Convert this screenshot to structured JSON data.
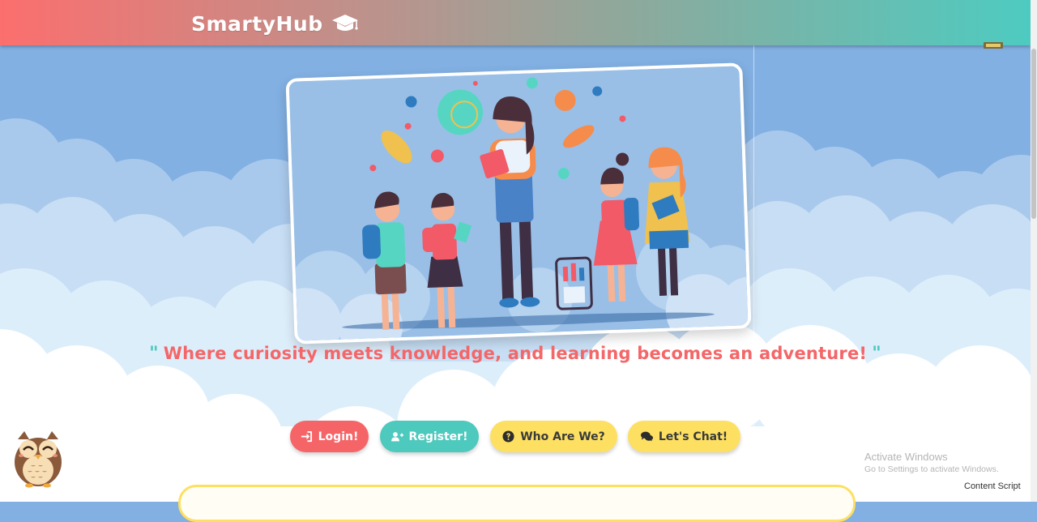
{
  "app": {
    "name": "SmartyHub",
    "logo_icon": "graduation-cap-icon"
  },
  "colors": {
    "header_gradient": [
      "#fb6f6e",
      "#4ecbc0"
    ],
    "primary_red": "#f56568",
    "teal": "#4ec9bd",
    "yellow": "#fde062",
    "sky": "#82b0e2"
  },
  "hero": {
    "illustration": "teacher-with-students-illustration"
  },
  "tagline": {
    "open_quote": "\"",
    "text": "Where curiosity meets knowledge, and learning becomes an adventure!",
    "close_quote": "\""
  },
  "buttons": {
    "login": {
      "label": "Login!",
      "icon": "sign-in-icon"
    },
    "register": {
      "label": "Register!",
      "icon": "user-plus-icon"
    },
    "who": {
      "label": "Who Are We?",
      "icon": "question-circle-icon"
    },
    "chat": {
      "label": "Let's Chat!",
      "icon": "comments-icon"
    }
  },
  "mascot": {
    "icon": "owl-icon"
  },
  "system": {
    "activate_title": "Activate Windows",
    "activate_sub": "Go to Settings to activate Windows.",
    "content_script": "Content Script"
  }
}
